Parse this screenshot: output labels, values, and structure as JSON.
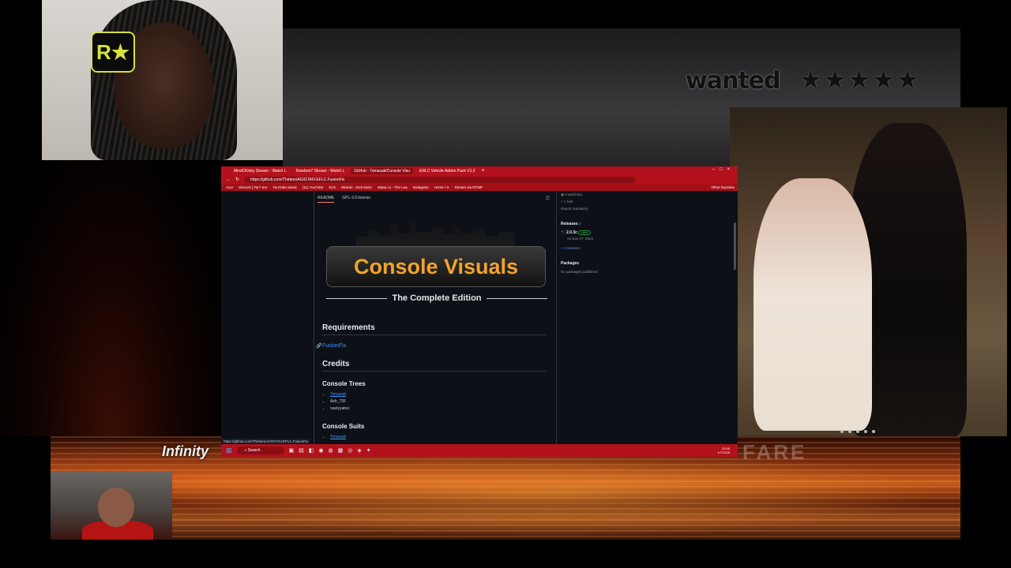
{
  "overlay": {
    "wanted_text": "wanted",
    "stars": "★★★★★",
    "infinity_logo": "Infinity",
    "fare_logo": "FARE"
  },
  "browser": {
    "tabs": [
      {
        "label": "MindOfJoky Stream - Watch L"
      },
      {
        "label": "Random7 Stream - Watch L"
      },
      {
        "label": "GitHub - Tomasak/Console Visu"
      },
      {
        "label": "ERLC Vehicle Addon Pack V1.2"
      }
    ],
    "active_tab": 2,
    "url": "https://github.com/ThirteenAG/GTAIV.EFLC.FusionFix",
    "bookmarks": [
      "Acer",
      "Discord | #ar7-era",
      "YouTube Music",
      "(11) YouTube",
      "Kick",
      "Stream - Kick Deriv",
      "Statui.co - The Lea",
      "Instagram",
      "Home / X",
      "Stream via RTMP"
    ],
    "other_favorites": "Other favorites",
    "status_url": "https://github.com/ThirteenAG/GTAIV.EFLC.FusionFix"
  },
  "readme": {
    "tabs": [
      "README",
      "GPL-3.0 license"
    ],
    "banner_title": "Console Visuals",
    "banner_subtitle": "The Complete Edition",
    "requirements_heading": "Requirements",
    "requirement_link": "FusionFix",
    "credits_heading": "Credits",
    "console_trees_heading": "Console Trees",
    "console_trees": [
      "Tomasak",
      "Ash_735",
      "nastyyaboi"
    ],
    "console_suits_heading": "Console Suits",
    "console_suits": [
      "Tomasak"
    ]
  },
  "sidebar": {
    "watching": "4 watching",
    "forks": "1 fork",
    "report": "Report repository",
    "releases_heading": "Releases",
    "releases_count": "3",
    "latest_version": "2.0.3c",
    "latest_badge": "Latest",
    "latest_date": "on Nov 27, 2024",
    "more_releases": "+ 2 releases",
    "packages_heading": "Packages",
    "packages_text": "No packages published"
  },
  "taskbar": {
    "search_placeholder": "Search",
    "clock_time": "23:39",
    "clock_date": "1/7/2025"
  },
  "colors": {
    "browser_theme": "#b3111b",
    "link": "#4493f8",
    "banner_title": "#f3a32b",
    "page_bg": "#0d1117"
  }
}
